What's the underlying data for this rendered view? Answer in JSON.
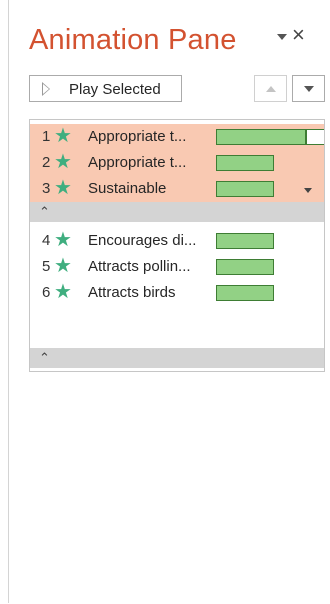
{
  "pane": {
    "title": "Animation Pane",
    "close_glyph": "×",
    "menu_icon": "dropdown-triangle-icon"
  },
  "toolbar": {
    "play_selected_label": "Play Selected",
    "play_icon": "play-icon",
    "move_up_icon": "triangle-up-icon",
    "move_down_icon": "triangle-down-icon"
  },
  "groups": [
    {
      "selected": true,
      "items": [
        {
          "num": "1",
          "name": "Appropriate t...",
          "icon": "star-icon"
        },
        {
          "num": "2",
          "name": "Appropriate t...",
          "icon": "star-icon"
        },
        {
          "num": "3",
          "name": "Sustainable",
          "icon": "star-icon"
        }
      ],
      "collapse_glyph": "≈"
    },
    {
      "selected": false,
      "items": [
        {
          "num": "4",
          "name": "Encourages di...",
          "icon": "star-icon"
        },
        {
          "num": "5",
          "name": "Attracts pollin...",
          "icon": "star-icon"
        },
        {
          "num": "6",
          "name": "Attracts birds",
          "icon": "star-icon"
        }
      ],
      "collapse_glyph": "≈"
    }
  ],
  "colors": {
    "title": "#d35230",
    "selected_row": "#f9c9b2",
    "star": "#3fae7f",
    "bar_fill": "#92d185",
    "bar_border": "#3e7d34",
    "separator": "#d4d4d4"
  }
}
